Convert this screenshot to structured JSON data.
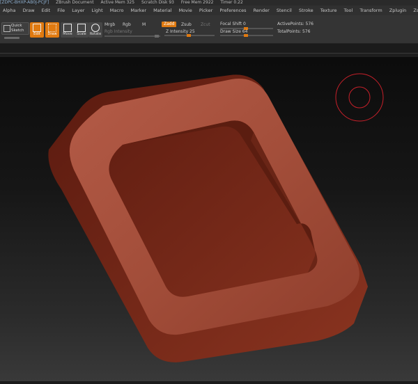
{
  "titlebar": {
    "items": [
      "[ZDPC-BHXP-AB0J-PCJF]",
      "ZBrush Document",
      "Active Mem 325",
      "Scratch Disk 93",
      "Free Mem 2922",
      "Timer 0.22"
    ]
  },
  "menu": {
    "items": [
      "Alpha",
      "Draw",
      "Edit",
      "File",
      "Layer",
      "Light",
      "Macro",
      "Marker",
      "Material",
      "Movie",
      "Picker",
      "Preferences",
      "Render",
      "Stencil",
      "Stroke",
      "Texture",
      "Tool",
      "Transform",
      "Zplugin",
      "Zscript"
    ]
  },
  "toolbar": {
    "quick_sketch_line1": "Quick",
    "quick_sketch_line2": "Sketch",
    "edit_label": "Edit",
    "draw_label": "Draw",
    "move_label": "Move",
    "scale_label": "Scale",
    "rotate_label": "Rotate",
    "mrgb_label": "Mrgb",
    "rgb_label": "Rgb",
    "m_label": "M",
    "zadd_label": "Zadd",
    "zsub_label": "Zsub",
    "zcut_label": "Zcut",
    "rgb_intensity_label": "Rgb Intensity",
    "z_intensity_label": "Z Intensity 25",
    "z_intensity_value": 25,
    "focal_shift_label": "Focal Shift 0",
    "focal_shift_value": 0,
    "draw_size_label": "Draw Size 64",
    "draw_size_value": 64,
    "active_points_label": "ActivePoints: 576",
    "total_points_label": "TotalPoints: 576"
  },
  "colors": {
    "accent": "#e07a10",
    "model": "#a9523f",
    "model_shadow": "#5a1c10",
    "cursor": "#c8202a"
  }
}
